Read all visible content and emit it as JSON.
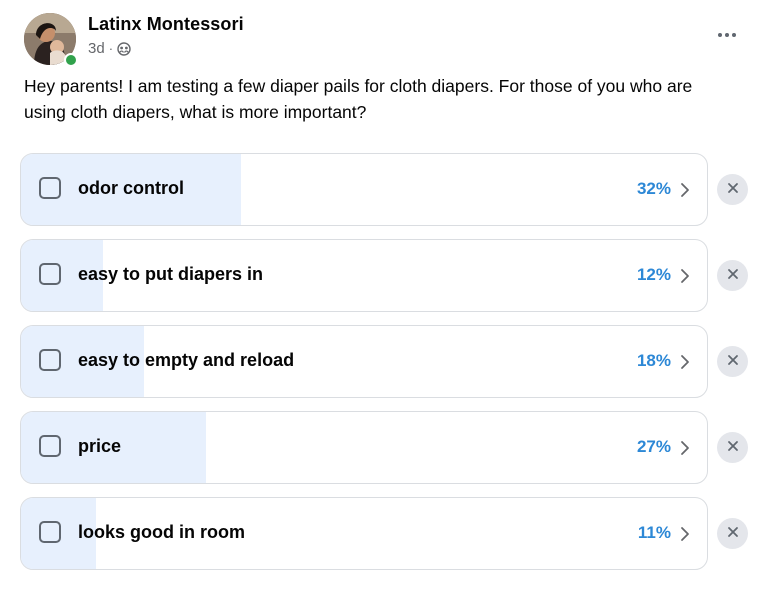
{
  "author": {
    "name": "Latinx Montessori",
    "time": "3d",
    "separator": "·",
    "audience_icon": "group-audience-icon",
    "online": true
  },
  "post": {
    "text": "Hey parents! I am testing a few diaper pails for cloth diapers. For those of you who are using cloth diapers, what is more important?"
  },
  "poll": {
    "options": [
      {
        "label": "odor control",
        "percent_text": "32%",
        "percent": 32
      },
      {
        "label": "easy to put diapers in",
        "percent_text": "12%",
        "percent": 12
      },
      {
        "label": "easy to empty and reload",
        "percent_text": "18%",
        "percent": 18
      },
      {
        "label": "price",
        "percent_text": "27%",
        "percent": 27
      },
      {
        "label": "looks good in room",
        "percent_text": "11%",
        "percent": 11
      }
    ]
  },
  "icons": {
    "more": "more-options-icon",
    "chevron": "chevron-right-icon",
    "remove": "close-icon"
  },
  "colors": {
    "fill": "#e7f0fd",
    "percent": "#2d88d6",
    "online": "#31a24c"
  }
}
